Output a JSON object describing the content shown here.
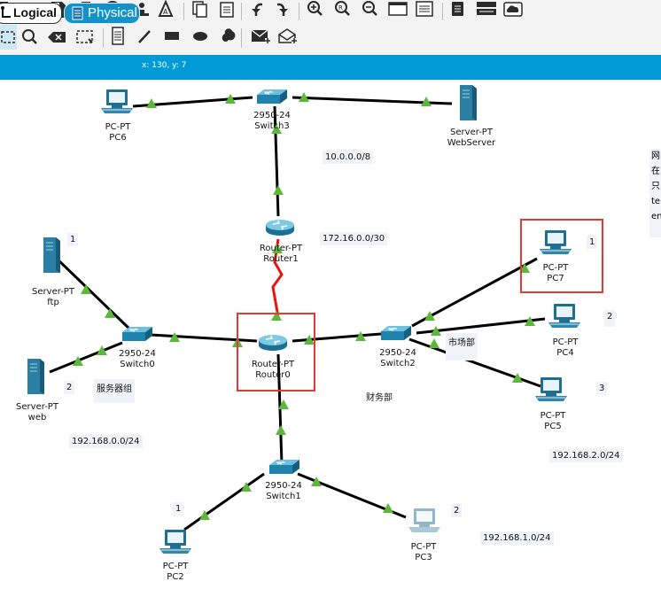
{
  "toolbar": {
    "row1_icons": [
      "new-icon",
      "open-icon",
      "save-icon",
      "print-icon",
      "info-icon",
      "network-wizard-icon",
      "activity-wizard-icon",
      "copy-icon",
      "paste-icon",
      "undo-icon",
      "redo-icon",
      "zoom-in-icon",
      "zoom-reset-icon",
      "zoom-out-icon",
      "drawing-palette-icon",
      "custom-devices-icon",
      "cluster-icon",
      "server-device-icon",
      "cloud-icon"
    ],
    "row2_icons": [
      "select-icon",
      "inspect-icon",
      "delete-icon",
      "resize-icon",
      "note-icon",
      "draw-line-icon",
      "draw-rectangle-icon",
      "draw-ellipse-icon",
      "freeform-icon",
      "add-simple-pdu-icon",
      "add-complex-pdu-icon"
    ]
  },
  "tabs": {
    "logical": "Logical",
    "physical": "Physical"
  },
  "coords": "x: 130, y: 7",
  "devices": {
    "pc6": {
      "model": "PC-PT",
      "name": "PC6"
    },
    "switch3": {
      "model": "2950-24",
      "name": "Switch3"
    },
    "webserver": {
      "model": "Server-PT",
      "name": "WebServer"
    },
    "router1": {
      "model": "Router-PT",
      "name": "Router1"
    },
    "ftp": {
      "model": "Server-PT",
      "name": "ftp"
    },
    "switch0": {
      "model": "2950-24",
      "name": "Switch0"
    },
    "web": {
      "model": "Server-PT",
      "name": "web"
    },
    "router0": {
      "model": "Router-PT",
      "name": "Router0"
    },
    "switch2": {
      "model": "2950-24",
      "name": "Switch2"
    },
    "pc7": {
      "model": "PC-PT",
      "name": "PC7"
    },
    "pc4": {
      "model": "PC-PT",
      "name": "PC4"
    },
    "pc5": {
      "model": "PC-PT",
      "name": "PC5"
    },
    "switch1": {
      "model": "2950-24",
      "name": "Switch1"
    },
    "pc2": {
      "model": "PC-PT",
      "name": "PC2"
    },
    "pc3": {
      "model": "PC-PT",
      "name": "PC3"
    }
  },
  "notes": {
    "net_10": "10.0.0.0/8",
    "net_172": "172.16.0.0/30",
    "net_192_0": "192.168.0.0/24",
    "net_192_1": "192.168.1.0/24",
    "net_192_2": "192.168.2.0/24",
    "server_group": "服务器组",
    "finance": "财务部",
    "market": "市场部",
    "n_ftp": "1",
    "n_web": "2",
    "n_pc7": "1",
    "n_pc4": "2",
    "n_pc5": "3",
    "n_pc2": "1",
    "n_pc3": "2"
  },
  "side_note": [
    "网",
    "在",
    "只",
    "tel",
    "en"
  ],
  "colors": {
    "tabbar": "#009bd7",
    "link": "#000000",
    "serial_link": "#e8130f",
    "port_up": "#5cb83a",
    "highlight": "#e53935",
    "note_bg": "#f1f3f8"
  }
}
